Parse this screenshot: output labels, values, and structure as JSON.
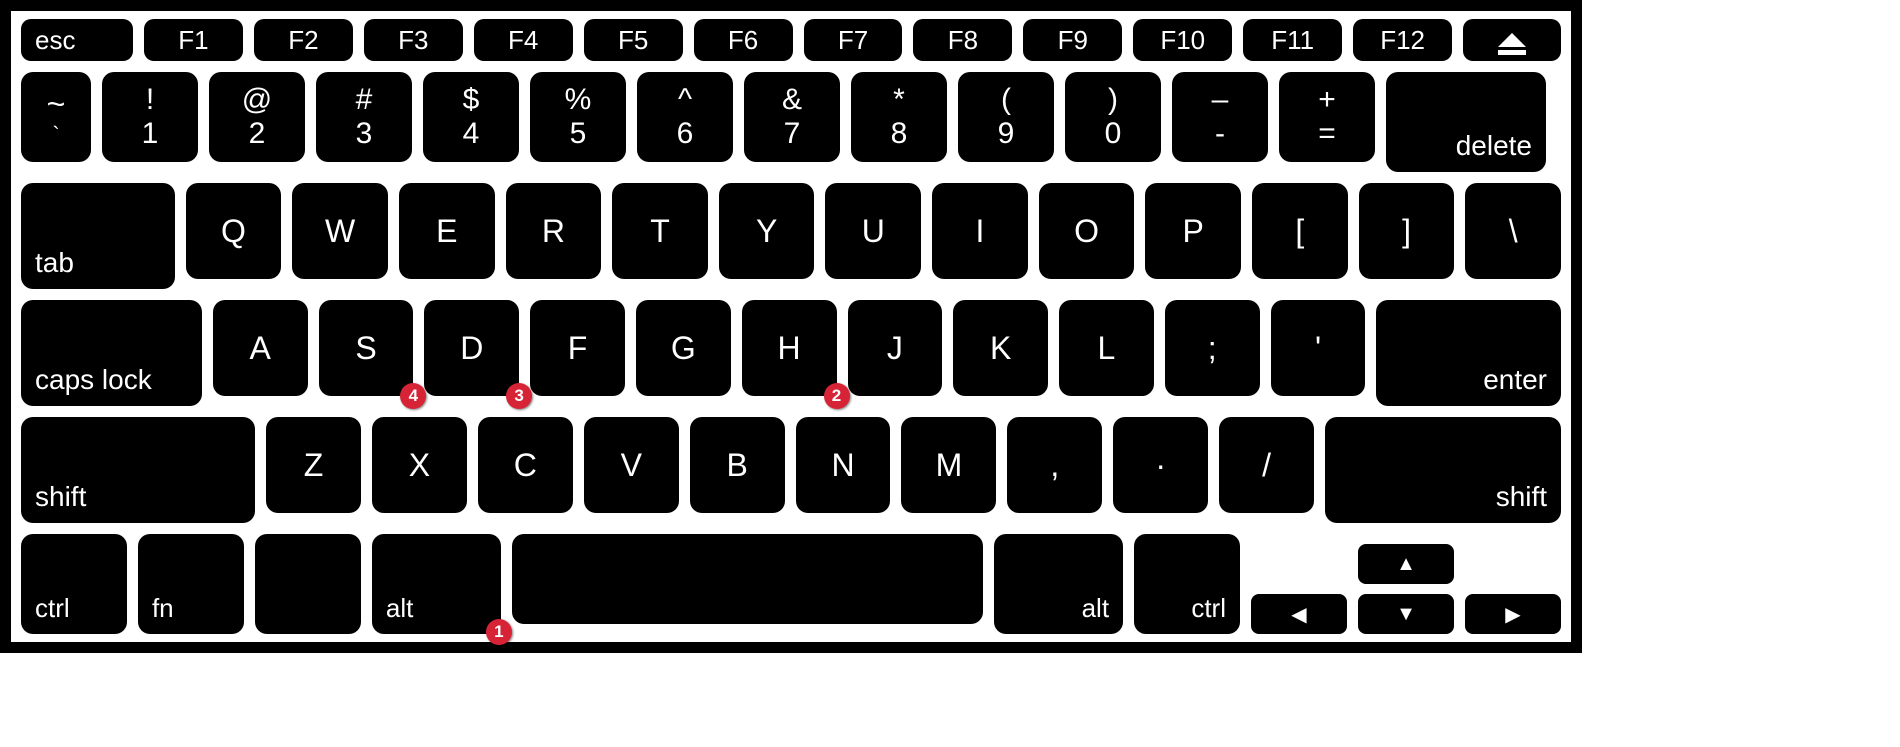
{
  "func": {
    "esc": "esc",
    "keys": [
      "F1",
      "F2",
      "F3",
      "F4",
      "F5",
      "F6",
      "F7",
      "F8",
      "F9",
      "F10",
      "F11",
      "F12"
    ],
    "eject": "eject"
  },
  "num": {
    "tilde_top": "~",
    "tilde_bot": "`",
    "k1_top": "!",
    "k1_bot": "1",
    "k2_top": "@",
    "k2_bot": "2",
    "k3_top": "#",
    "k3_bot": "3",
    "k4_top": "$",
    "k4_bot": "4",
    "k5_top": "%",
    "k5_bot": "5",
    "k6_top": "^",
    "k6_bot": "6",
    "k7_top": "&",
    "k7_bot": "7",
    "k8_top": "*",
    "k8_bot": "8",
    "k9_top": "(",
    "k9_bot": "9",
    "k0_top": ")",
    "k0_bot": "0",
    "minus_top": "–",
    "minus_bot": "-",
    "eq_top": "+",
    "eq_bot": "=",
    "delete": "delete"
  },
  "q": {
    "tab": "tab",
    "letters": [
      "Q",
      "W",
      "E",
      "R",
      "T",
      "Y",
      "U",
      "I",
      "O",
      "P"
    ],
    "lb": "[",
    "rb": "]",
    "bs": "\\"
  },
  "a": {
    "caps": "caps lock",
    "letters": [
      "A",
      "S",
      "D",
      "F",
      "G",
      "H",
      "J",
      "K",
      "L"
    ],
    "semi": ";",
    "quote": "'",
    "enter": "enter"
  },
  "z": {
    "shift_l": "shift",
    "letters": [
      "Z",
      "X",
      "C",
      "V",
      "B",
      "N",
      "M"
    ],
    "comma": ",",
    "dot": "·",
    "slash": "/",
    "shift_r": "shift"
  },
  "bottom": {
    "ctrl_l": "ctrl",
    "fn": "fn",
    "alt_l": "alt",
    "space": "",
    "alt_r": "alt",
    "ctrl_r": "ctrl"
  },
  "arrows": {
    "up": "▲",
    "down": "▼",
    "left": "◀",
    "right": "▶"
  },
  "badges": {
    "b1": "1",
    "b2": "2",
    "b3": "3",
    "b4": "4"
  }
}
